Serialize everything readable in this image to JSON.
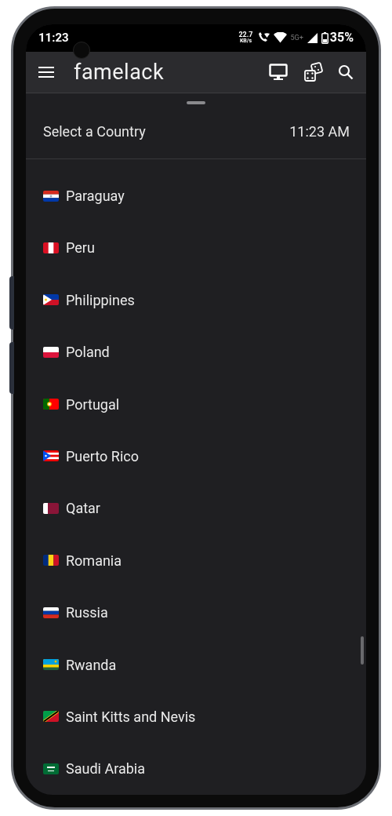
{
  "status_bar": {
    "time": "11:23",
    "net_speed": "22.7",
    "net_unit": "KB/s",
    "network": "5G+",
    "battery": "35%"
  },
  "app_bar": {
    "title": "famelack"
  },
  "sheet": {
    "title": "Select a Country",
    "time": "11:23 AM"
  },
  "countries": [
    {
      "name": "Paraguay",
      "kind": "py"
    },
    {
      "name": "Peru",
      "kind": "pe"
    },
    {
      "name": "Philippines",
      "kind": "ph"
    },
    {
      "name": "Poland",
      "kind": "pl"
    },
    {
      "name": "Portugal",
      "kind": "pt"
    },
    {
      "name": "Puerto Rico",
      "kind": "pr"
    },
    {
      "name": "Qatar",
      "kind": "qa"
    },
    {
      "name": "Romania",
      "kind": "ro"
    },
    {
      "name": "Russia",
      "kind": "ru"
    },
    {
      "name": "Rwanda",
      "kind": "rw"
    },
    {
      "name": "Saint Kitts and Nevis",
      "kind": "kn"
    },
    {
      "name": "Saudi Arabia",
      "kind": "sa"
    }
  ]
}
